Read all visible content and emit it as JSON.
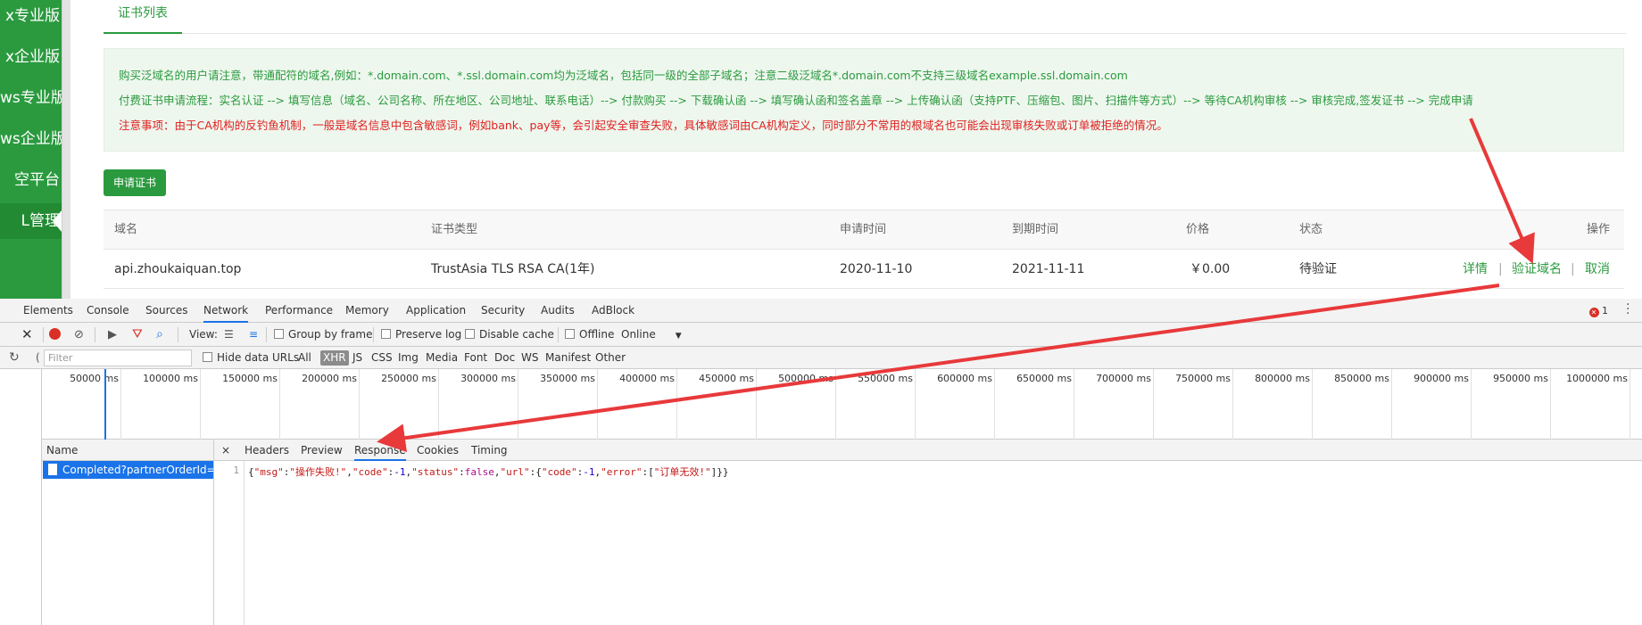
{
  "sidebar": {
    "items": [
      {
        "label": "x专业版"
      },
      {
        "label": "x企业版"
      },
      {
        "label": "ws专业版"
      },
      {
        "label": "ws企业版"
      },
      {
        "label": "空平台"
      },
      {
        "label": "L管理"
      }
    ]
  },
  "page_tabs": {
    "cert_list": "证书列表"
  },
  "notice": {
    "line1": "购买泛域名的用户请注意，带通配符的域名,例如：*.domain.com、*.ssl.domain.com均为泛域名，包括同一级的全部子域名；注意二级泛域名*.domain.com不支持三级域名example.ssl.domain.com",
    "line2": "付费证书申请流程：实名认证 --> 填写信息（域名、公司名称、所在地区、公司地址、联系电话）--> 付款购买 --> 下载确认函 --> 填写确认函和签名盖章 --> 上传确认函（支持PTF、压缩包、图片、扫描件等方式）--> 等待CA机构审核 --> 审核完成,签发证书 --> 完成申请",
    "line3": "注意事项：由于CA机构的反钓鱼机制，一般是域名信息中包含敏感词，例如bank、pay等，会引起安全审查失败，具体敏感词由CA机构定义，同时部分不常用的根域名也可能会出现审核失败或订单被拒绝的情况。"
  },
  "apply_button": "申请证书",
  "cert_table": {
    "headers": {
      "domain": "域名",
      "type": "证书类型",
      "apply_time": "申请时间",
      "expire_time": "到期时间",
      "price": "价格",
      "status": "状态",
      "actions": "操作"
    },
    "rows": [
      {
        "domain": "api.zhoukaiquan.top",
        "type": "TrustAsia TLS RSA CA(1年)",
        "apply_time": "2020-11-10",
        "expire_time": "2021-11-11",
        "price": "￥0.00",
        "status": "待验证",
        "action_detail": "详情",
        "action_verify": "验证域名",
        "action_cancel": "取消",
        "separator": "|"
      }
    ]
  },
  "devtools": {
    "tabs": [
      "Elements",
      "Console",
      "Sources",
      "Network",
      "Performance",
      "Memory",
      "Application",
      "Security",
      "Audits",
      "AdBlock"
    ],
    "active_tab": "Network",
    "error_count": "1",
    "toolbar": {
      "view_label": "View:",
      "group_by_frame": "Group by frame",
      "preserve_log": "Preserve log",
      "disable_cache": "Disable cache",
      "offline": "Offline",
      "throttle": "Online",
      "throttle_caret": "▼"
    },
    "filterbar": {
      "filter_placeholder": "Filter",
      "hide_data_urls": "Hide data URLs",
      "types": [
        "All",
        "XHR",
        "JS",
        "CSS",
        "Img",
        "Media",
        "Font",
        "Doc",
        "WS",
        "Manifest",
        "Other"
      ],
      "selected_type": "XHR"
    },
    "timeline_ticks": [
      "50000 ms",
      "100000 ms",
      "150000 ms",
      "200000 ms",
      "250000 ms",
      "300000 ms",
      "350000 ms",
      "400000 ms",
      "450000 ms",
      "500000 ms",
      "550000 ms",
      "600000 ms",
      "650000 ms",
      "700000 ms",
      "750000 ms",
      "800000 ms",
      "850000 ms",
      "900000 ms",
      "950000 ms",
      "1000000 ms"
    ],
    "name_header": "Name",
    "request_name": "Completed?partnerOrderId=...",
    "detail_close": "×",
    "detail_tabs": [
      "Headers",
      "Preview",
      "Response",
      "Cookies",
      "Timing"
    ],
    "active_detail_tab": "Response",
    "response": {
      "line_number": "1",
      "text": "{\"msg\":\"操作失败!\",\"code\":-1,\"status\":false,\"url\":{\"code\":-1,\"error\":[\"订单无效!\"]}}"
    }
  },
  "colors": {
    "brand_green": "#2b9a3f",
    "warning_red": "#e02020",
    "devtools_blue": "#1a73e8",
    "arrow_red": "#e8393b"
  }
}
